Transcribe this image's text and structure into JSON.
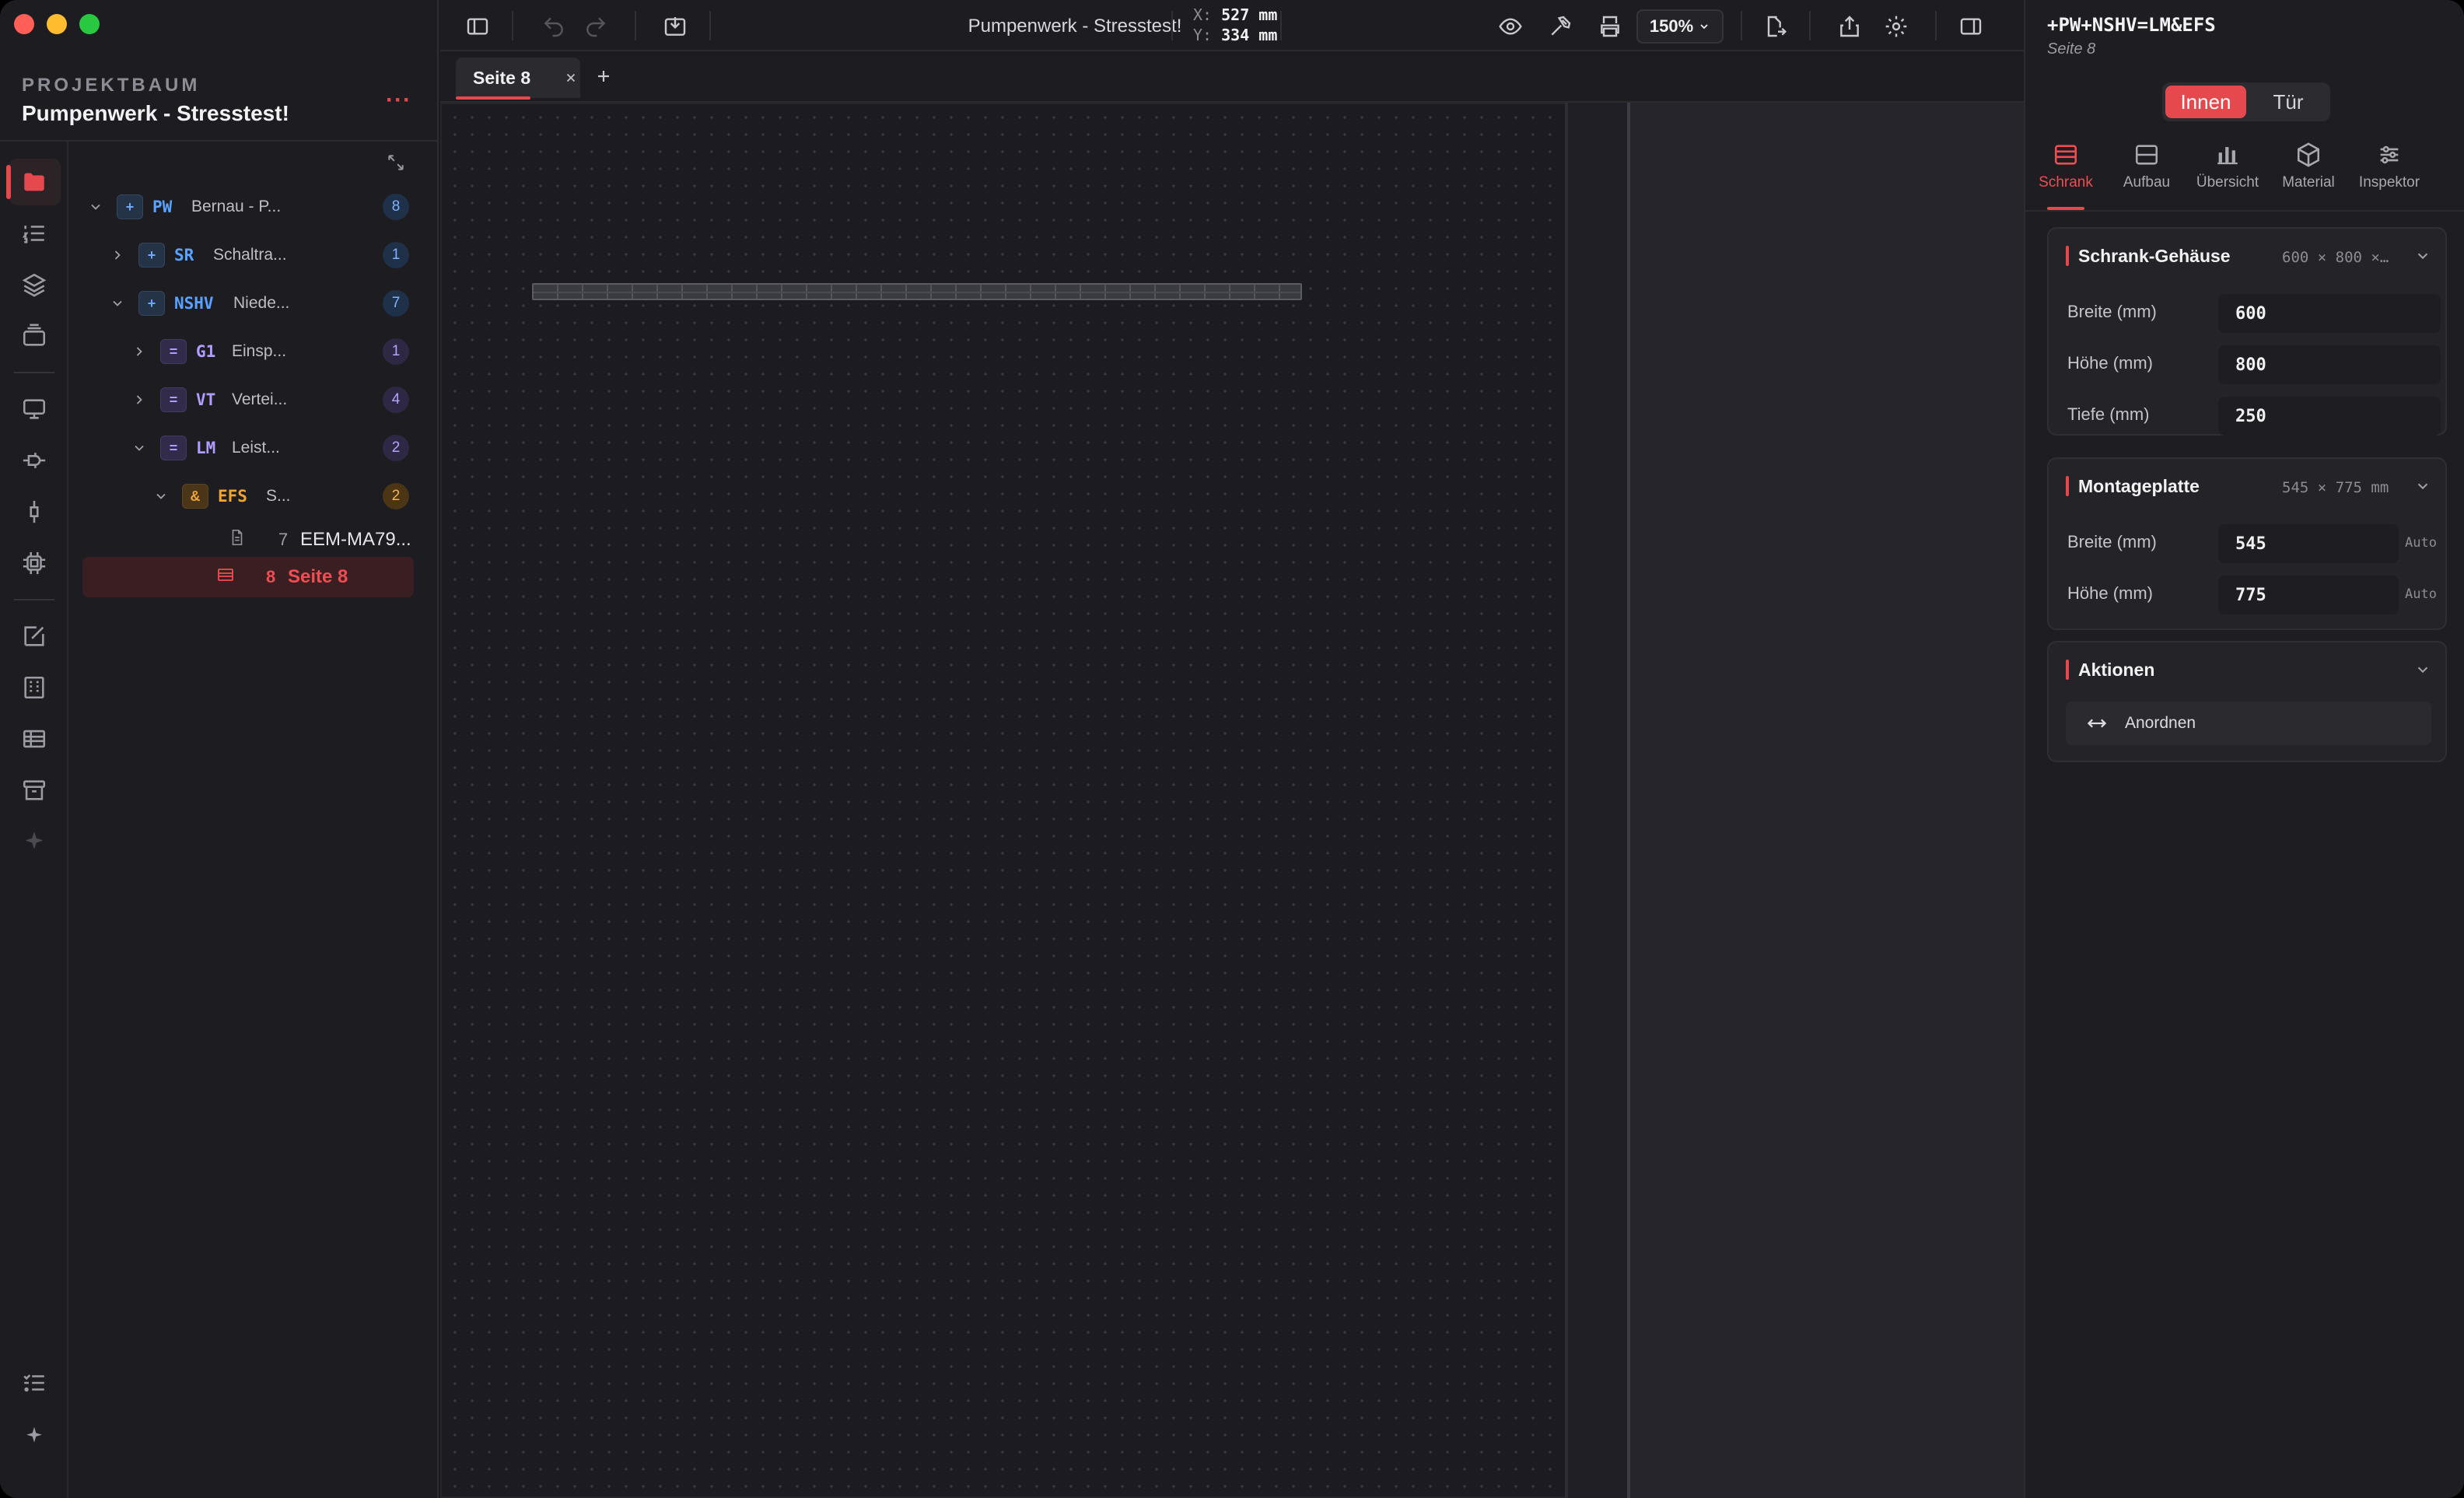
{
  "window": {
    "title": "Pumpenwerk - Stresstest!"
  },
  "project": {
    "label": "PROJEKTBAUM",
    "title": "Pumpenwerk - Stresstest!",
    "more": "···"
  },
  "tree": {
    "nodes": [
      {
        "code": "PW",
        "name": "Bernau - P...",
        "count": "8",
        "badge": "+"
      },
      {
        "code": "SR",
        "name": "Schaltra...",
        "count": "1",
        "badge": "+"
      },
      {
        "code": "NSHV",
        "name": "Niede...",
        "count": "7",
        "badge": "+"
      },
      {
        "code": "G1",
        "name": "Einsp...",
        "count": "1",
        "badge": "="
      },
      {
        "code": "VT",
        "name": "Vertei...",
        "count": "4",
        "badge": "="
      },
      {
        "code": "LM",
        "name": "Leist...",
        "count": "2",
        "badge": "="
      },
      {
        "code": "EFS",
        "name": "S...",
        "count": "2",
        "badge": "&"
      }
    ],
    "pages": [
      {
        "num": "7",
        "name": "EEM-MA79..."
      },
      {
        "num": "8",
        "name": "Seite 8"
      }
    ]
  },
  "toolbar": {
    "coords": {
      "x_label": "X:",
      "x_value": "527 mm",
      "y_label": "Y:",
      "y_value": "334 mm"
    },
    "zoom": "150%"
  },
  "tabs": [
    {
      "label": "Seite 8"
    }
  ],
  "inspector": {
    "path": "+PW+NSHV=LM&EFS",
    "subtitle": "Seite 8",
    "segments": [
      {
        "label": "Innen",
        "active": true
      },
      {
        "label": "Tür",
        "active": false
      }
    ],
    "tabs": [
      {
        "label": "Schrank",
        "icon": "cabinet-icon",
        "active": true
      },
      {
        "label": "Aufbau",
        "icon": "layout-icon",
        "active": false
      },
      {
        "label": "Übersicht",
        "icon": "bar-chart-icon",
        "active": false
      },
      {
        "label": "Material",
        "icon": "cube-icon",
        "active": false
      },
      {
        "label": "Inspektor",
        "icon": "sliders-icon",
        "active": false
      }
    ],
    "housing": {
      "title": "Schrank-Gehäuse",
      "summary": "600 × 800 ×…",
      "fields": [
        {
          "label": "Breite (mm)",
          "value": "600"
        },
        {
          "label": "Höhe (mm)",
          "value": "800"
        },
        {
          "label": "Tiefe (mm)",
          "value": "250"
        }
      ]
    },
    "plate": {
      "title": "Montageplatte",
      "summary": "545 × 775 mm",
      "fields": [
        {
          "label": "Breite (mm)",
          "value": "545",
          "hint": "Auto"
        },
        {
          "label": "Höhe (mm)",
          "value": "775",
          "hint": "Auto"
        }
      ]
    },
    "actions": {
      "title": "Aktionen",
      "arrange": "Anordnen"
    }
  },
  "colors": {
    "accent": "#e5484d",
    "blue": "#5aa2ff",
    "purple": "#b29cff",
    "orange": "#f0a436"
  }
}
